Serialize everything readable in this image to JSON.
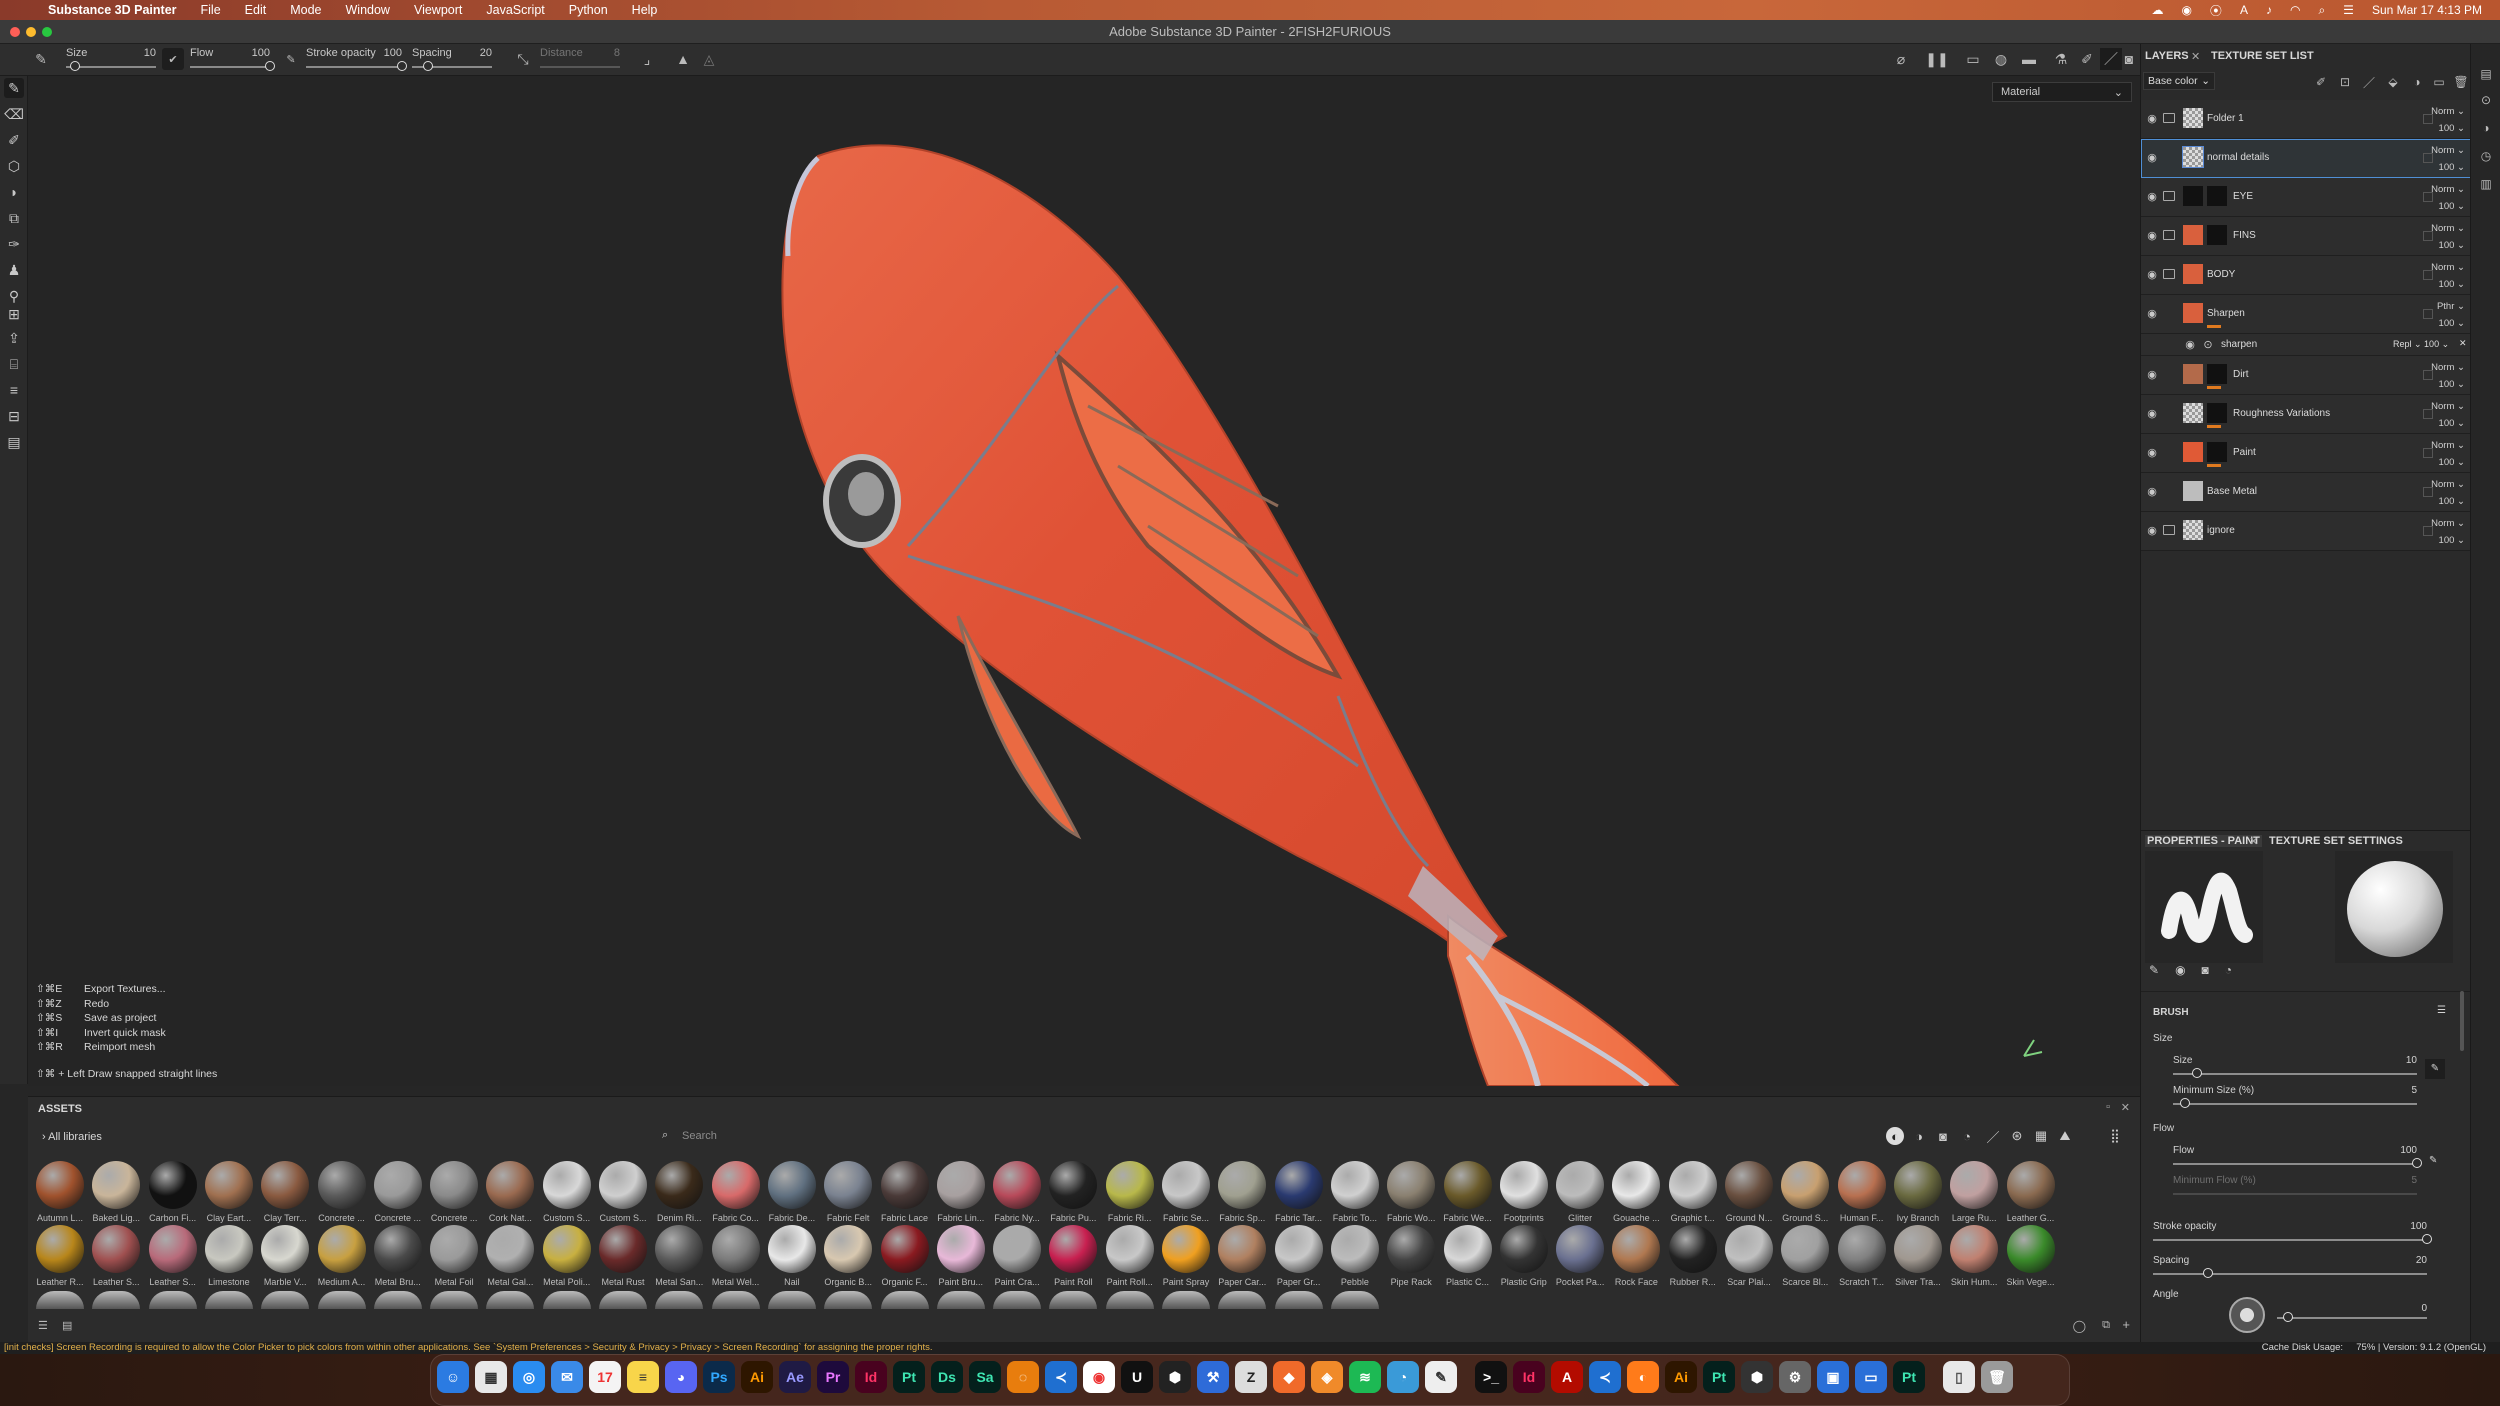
{
  "macmenu": {
    "app_name": "Substance 3D Painter",
    "menus": [
      "File",
      "Edit",
      "Mode",
      "Window",
      "Viewport",
      "JavaScript",
      "Python",
      "Help"
    ],
    "clock": "Sun Mar 17  4:13 PM"
  },
  "window": {
    "title": "Adobe Substance 3D Painter - 2FISH2FURIOUS"
  },
  "toolbar": {
    "size_label": "Size",
    "size_value": "10",
    "size": 0.1,
    "flow_label": "Flow",
    "flow_value": "100",
    "flow": 1.0,
    "stroke_opacity_label": "Stroke opacity",
    "stroke_opacity_value": "100",
    "stroke_opacity": 1.0,
    "spacing_label": "Spacing",
    "spacing_value": "20",
    "spacing": 0.2,
    "distance_label": "Distance",
    "distance_value": "8"
  },
  "viewport": {
    "material_mode": "Material",
    "shortcuts": [
      {
        "keys": "⇧⌘E",
        "action": "Export Textures..."
      },
      {
        "keys": "⇧⌘Z",
        "action": "Redo"
      },
      {
        "keys": "⇧⌘S",
        "action": "Save as project"
      },
      {
        "keys": "⇧⌘I",
        "action": "Invert quick mask"
      },
      {
        "keys": "⇧⌘R",
        "action": "Reimport mesh"
      }
    ],
    "hint": "⇧⌘ + Left  Draw snapped straight lines"
  },
  "assets": {
    "title": "ASSETS",
    "library": "All libraries",
    "search_placeholder": "Search",
    "row1": [
      "Autumn L...",
      "Baked Lig...",
      "Carbon Fi...",
      "Clay Eart...",
      "Clay Terr...",
      "Concrete ...",
      "Concrete ...",
      "Concrete ...",
      "Cork Nat...",
      "Custom S...",
      "Custom S...",
      "Denim Ri...",
      "Fabric Co...",
      "Fabric De...",
      "Fabric Felt",
      "Fabric Lace",
      "Fabric Lin...",
      "Fabric Ny...",
      "Fabric Pu...",
      "Fabric Ri...",
      "Fabric Se...",
      "Fabric Sp...",
      "Fabric Tar...",
      "Fabric To...",
      "Fabric Wo...",
      "Fabric We...",
      "Footprints",
      "Glitter",
      "Gouache ...",
      "Graphic t...",
      "Ground N...",
      "Ground S...",
      "Human F...",
      "Ivy Branch",
      "Large Ru...",
      "Leather G..."
    ],
    "row2": [
      "Leather R...",
      "Leather S...",
      "Leather S...",
      "Limestone",
      "Marble V...",
      "Medium A...",
      "Metal Bru...",
      "Metal Foil",
      "Metal Gal...",
      "Metal Poli...",
      "Metal Rust",
      "Metal San...",
      "Metal Wel...",
      "Nail",
      "Organic B...",
      "Organic F...",
      "Paint Bru...",
      "Paint Cra...",
      "Paint Roll",
      "Paint Roll...",
      "Paint Spray",
      "Paper Car...",
      "Paper Gr...",
      "Pebble",
      "Pipe Rack",
      "Plastic C...",
      "Plastic Grip",
      "Pocket Pa...",
      "Rock Face",
      "Rubber R...",
      "Scar Plai...",
      "Scarce Bl...",
      "Scratch T...",
      "Silver Tra...",
      "Skin Hum...",
      "Skin Vege..."
    ]
  },
  "status": {
    "message": "[init checks] Screen Recording is required to allow the Color Picker to pick colors from within other applications. See `System Preferences > Security & Privacy > Privacy > Screen Recording` for assigning the proper rights.",
    "cache_label": "Cache Disk Usage:",
    "cache_value": "75% | Version: 9.1.2 (OpenGL)"
  },
  "layers_panel": {
    "tab_layers": "LAYERS",
    "tab_texture_set_list": "TEXTURE SET LIST",
    "channel": "Base color",
    "layers": [
      {
        "name": "Folder 1",
        "blend": "Norm",
        "opacity": "100"
      },
      {
        "name": "normal details",
        "blend": "Norm",
        "opacity": "100"
      },
      {
        "name": "EYE",
        "blend": "Norm",
        "opacity": "100"
      },
      {
        "name": "FINS",
        "blend": "Norm",
        "opacity": "100"
      },
      {
        "name": "BODY",
        "blend": "Norm",
        "opacity": "100"
      },
      {
        "name": "Sharpen",
        "blend": "Pthr",
        "opacity": "100"
      },
      {
        "name": "Dirt",
        "blend": "Norm",
        "opacity": "100"
      },
      {
        "name": "Roughness Variations",
        "blend": "Norm",
        "opacity": "100"
      },
      {
        "name": "Paint",
        "blend": "Norm",
        "opacity": "100"
      },
      {
        "name": "Base Metal",
        "blend": "Norm",
        "opacity": "100"
      },
      {
        "name": "ignore",
        "blend": "Norm",
        "opacity": "100"
      }
    ],
    "sublayer": {
      "name": "sharpen",
      "blend": "Repl",
      "opacity": "100"
    }
  },
  "properties": {
    "tab_paint": "PROPERTIES - PAINT",
    "tab_tss": "TEXTURE SET SETTINGS",
    "section": "BRUSH",
    "size_group": "Size",
    "size_label": "Size",
    "size_value": "10",
    "size": 0.1,
    "min_size_label": "Minimum Size (%)",
    "min_size_value": "5",
    "min_size": 0.05,
    "flow_group": "Flow",
    "flow_label": "Flow",
    "flow_value": "100",
    "flow": 1.0,
    "min_flow_label": "Minimum Flow (%)",
    "min_flow_value": "5",
    "min_flow": 0.05,
    "stroke_opacity_label": "Stroke opacity",
    "stroke_opacity_value": "100",
    "stroke_opacity": 1.0,
    "spacing_label": "Spacing",
    "spacing_value": "20",
    "spacing": 0.2,
    "angle_label": "Angle",
    "angle_value": "0"
  },
  "dock": {
    "labels": [
      "Ps",
      "Ai",
      "Ae",
      "Pr",
      "Id",
      "Pt",
      "Ds",
      "Sa",
      "Id",
      "Ai",
      "Pt",
      "Pt"
    ]
  },
  "colors": {
    "accent": "#e07a1f",
    "fish": "#e0563a",
    "selection": "#4f8fd6"
  }
}
